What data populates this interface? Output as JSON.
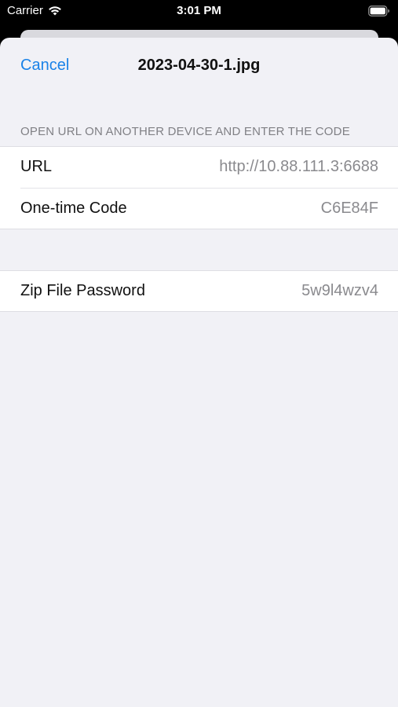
{
  "status_bar": {
    "carrier": "Carrier",
    "time": "3:01 PM",
    "wifi_icon": "wifi-icon",
    "battery_icon": "battery-icon"
  },
  "nav": {
    "cancel_label": "Cancel",
    "title": "2023-04-30-1.jpg"
  },
  "section": {
    "header": "OPEN URL ON ANOTHER DEVICE AND ENTER THE CODE"
  },
  "rows": [
    {
      "label": "URL",
      "value": "http://10.88.111.3:6688"
    },
    {
      "label": "One-time Code",
      "value": "C6E84F"
    }
  ],
  "password_row": {
    "label": "Zip File Password",
    "value": "5w9l4wzv4"
  },
  "colors": {
    "accent": "#1a82e8",
    "background": "#f1f1f6",
    "secondary_text": "#8a8a8e"
  }
}
